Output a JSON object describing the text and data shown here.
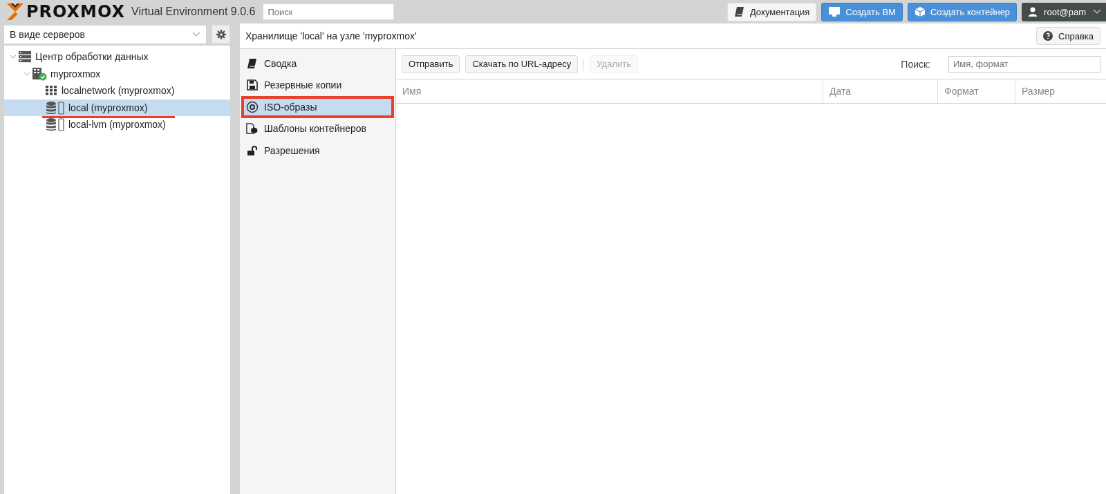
{
  "topbar": {
    "logo": "PROXMOX",
    "product": "Virtual Environment 9.0.6",
    "search": {
      "placeholder": "Поиск"
    },
    "buttons": [
      {
        "label": "Документация",
        "kind": "docs"
      },
      {
        "label": "Создать ВМ",
        "kind": "vm"
      },
      {
        "label": "Создать контейнер",
        "kind": "ct"
      }
    ],
    "user": "root@pam"
  },
  "sidebar": {
    "view": "В виде серверов",
    "tree": [
      {
        "label": "Центр обработки данных",
        "kind": "datacenter",
        "expanded": true,
        "selected": false,
        "children": [
          {
            "label": "myproxmox",
            "kind": "node",
            "expanded": true,
            "selected": false,
            "children": [
              {
                "label": "localnetwork (myproxmox)",
                "kind": "network",
                "selected": false
              },
              {
                "label": "local (myproxmox)",
                "kind": "storage",
                "selected": true,
                "annotated": true
              },
              {
                "label": "local-lvm (myproxmox)",
                "kind": "storage",
                "selected": false
              }
            ]
          }
        ]
      }
    ]
  },
  "content": {
    "title": "Хранилище 'local' на узле 'myproxmox'",
    "help": "Справка",
    "nav": [
      {
        "label": "Сводка",
        "kind": "summary",
        "selected": false
      },
      {
        "label": "Резервные копии",
        "kind": "backup",
        "selected": false
      },
      {
        "label": "ISO-образы",
        "kind": "iso",
        "selected": true,
        "annotated": true
      },
      {
        "label": "Шаблоны контейнеров",
        "kind": "template",
        "selected": false
      },
      {
        "label": "Разрешения",
        "kind": "permissions",
        "selected": false
      }
    ],
    "toolbar": [
      {
        "label": "Отправить",
        "disabled": false
      },
      {
        "label": "Скачать по URL-адресу",
        "disabled": false
      },
      {
        "label": "Удалить",
        "disabled": true
      }
    ],
    "search_label": "Поиск:",
    "search": {
      "placeholder": "Имя, формат"
    },
    "table": {
      "columns": [
        {
          "label": "Имя",
          "kind": "wide"
        },
        {
          "label": "Дата",
          "kind": "mid"
        },
        {
          "label": "Формат",
          "kind": "small"
        },
        {
          "label": "Размер",
          "kind": "small"
        }
      ]
    }
  }
}
